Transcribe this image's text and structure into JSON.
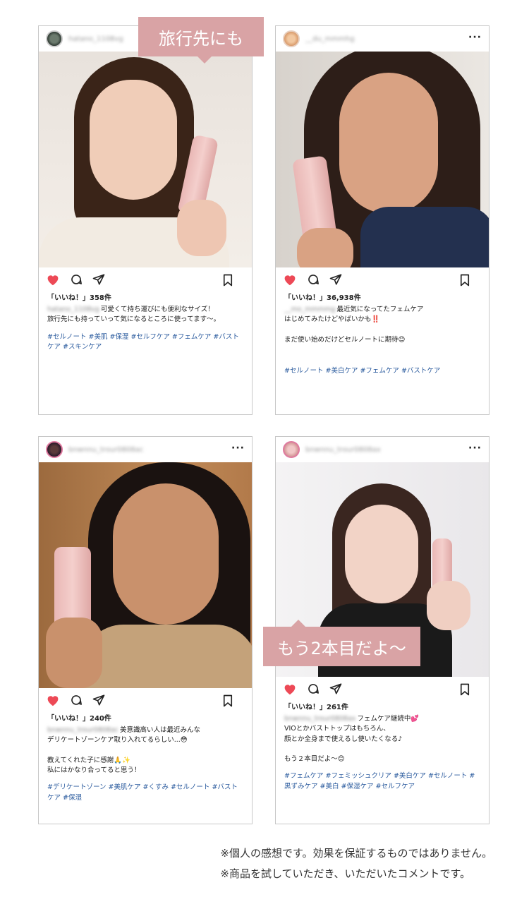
{
  "posts": [
    {
      "username": "hatano_1108vg",
      "likes": "「いいね！」358件",
      "caption_user": "hatano_1108vg",
      "caption": "可愛くて持ち運びにも便利なサイズ！\n旅行先にも持っていって気になるところに使ってます〜。",
      "hashtags": "#セルノート #美肌 #保湿 #セルフケア #フェムケア #バストケア #スキンケア"
    },
    {
      "username": "__du_mmmhg",
      "likes": "「いいね！」36,938件",
      "caption_user": "__mo_mmmmg",
      "caption": "最近気になってたフェムケア\nはじめてみたけどやばいかも‼️\n\nまだ使い始めだけどセルノートに期待😊",
      "hashtags": "#セルノート #美白ケア #フェムケア #バストケア"
    },
    {
      "username": "bnwnnu_trour0808ac",
      "likes": "「いいね！」240件",
      "caption_user": "bnwnnu_trour0808ac",
      "caption": "美意識高い人は最近みんな\nデリケートゾーンケア取り入れてるらしい...😳\n\n教えてくれた子に感謝🙏✨\n私にはかなり合ってると思う！",
      "hashtags": "#デリケートゾーン #美肌ケア #くすみ #セルノート #バストケア #保湿"
    },
    {
      "username": "bnwnnu_trour0808ax",
      "likes": "「いいね！」261件",
      "caption_user": "bnwnnu_trour0808ax",
      "caption": "フェムケア継続中💕\nVIOとかバストトップはもちろん、\n顔とか全身まで使えるし使いたくなる♪\n\nもう２本目だよ〜😊",
      "hashtags": "#フェムケア #フェミッシュクリア #美白ケア #セルノート #黒ずみケア #美白 #保湿ケア #セルフケア"
    }
  ],
  "banners": {
    "top": "旅行先にも",
    "bottom": "もう2本目だよ〜"
  },
  "disclaimer": {
    "line1": "※個人の感想です。効果を保証するものではありません。",
    "line2": "※商品を試していただき、いただいたコメントです。"
  },
  "colors": {
    "heart": "#ed4956",
    "banner": "#d9a3a5",
    "hashtag": "#2b5b9e"
  }
}
